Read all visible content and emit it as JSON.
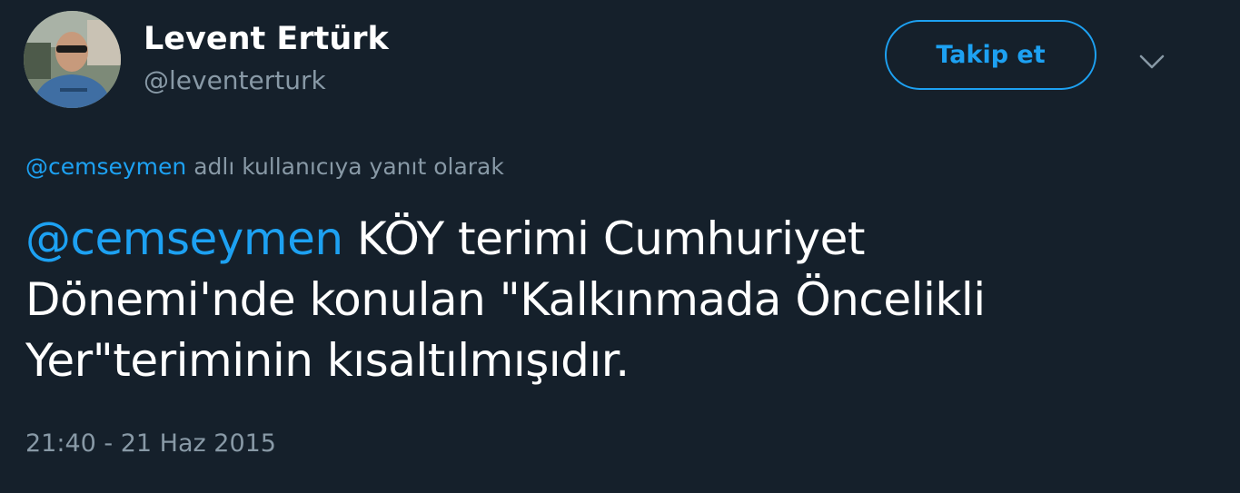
{
  "author": {
    "display_name": "Levent Ertürk",
    "handle": "@leventerturk",
    "avatar_icon": "user-avatar-photo"
  },
  "follow_button": {
    "label": "Takip et"
  },
  "menu": {
    "icon": "chevron-down-icon"
  },
  "reply_context": {
    "mention": "@cemseymen",
    "text": " adlı kullanıcıya yanıt olarak"
  },
  "tweet": {
    "mention": "@cemseymen",
    "body_line1": " KÖY terimi Cumhuriyet",
    "body_line2": "Dönemi'nde konulan \"Kalkınmada Öncelikli",
    "body_line3": "Yer\"teriminin kısaltılmışıdır."
  },
  "timestamp": "21:40 - 21 Haz 2015",
  "colors": {
    "background": "#15202b",
    "accent": "#1da1f2",
    "secondary_text": "#8899a6",
    "primary_text": "#ffffff"
  }
}
